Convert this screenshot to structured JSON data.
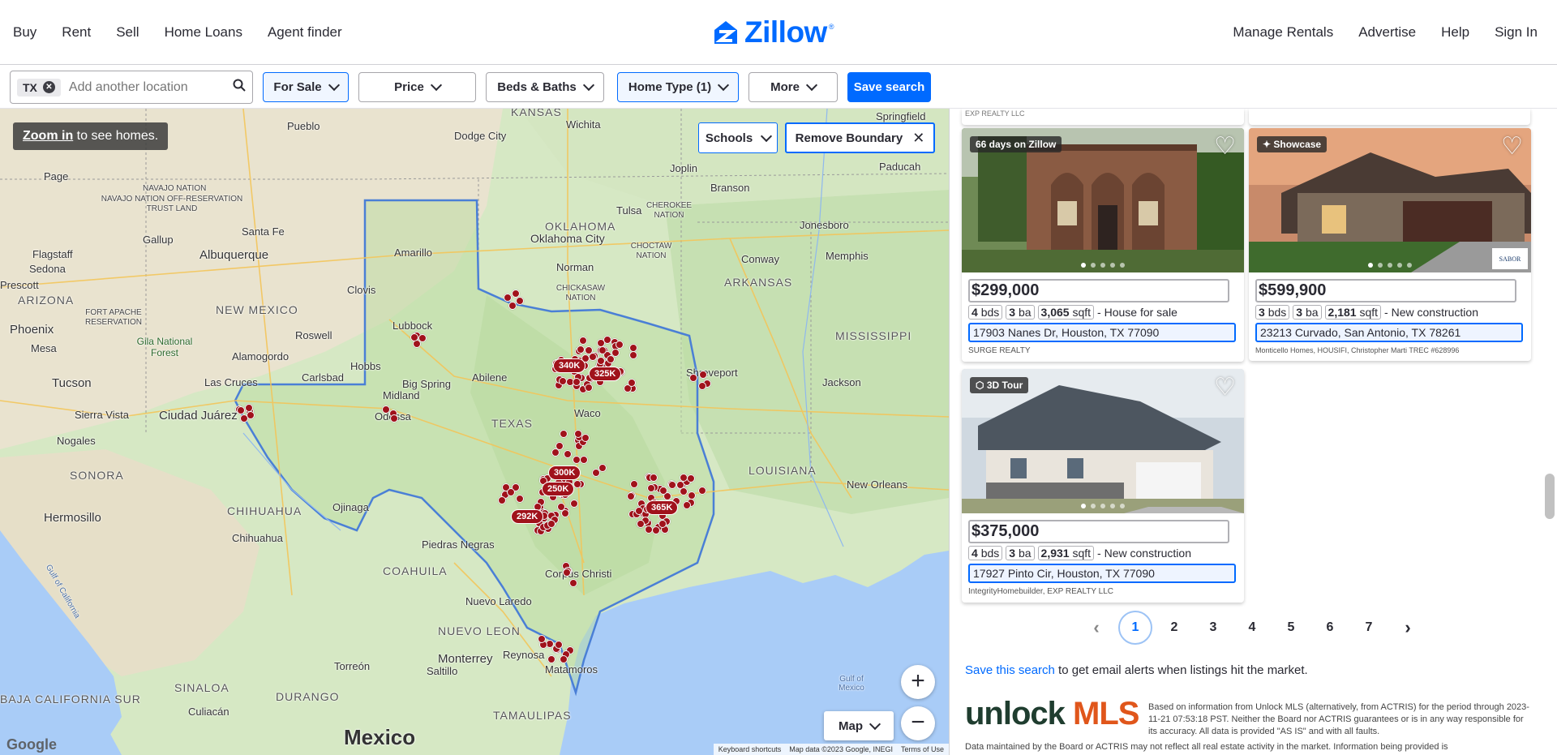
{
  "nav": {
    "left": [
      "Buy",
      "Rent",
      "Sell",
      "Home Loans",
      "Agent finder"
    ],
    "logo": "Zillow",
    "right": [
      "Manage Rentals",
      "Advertise",
      "Help",
      "Sign In"
    ]
  },
  "filters": {
    "location_chip": "TX",
    "search_placeholder": "Add another location",
    "for_sale": "For Sale",
    "price": "Price",
    "beds_baths": "Beds & Baths",
    "home_type": "Home Type (1)",
    "more": "More",
    "save_search": "Save search"
  },
  "map": {
    "zoom_tip_link": "Zoom in",
    "zoom_tip_rest": " to see homes.",
    "schools": "Schools",
    "remove_boundary": "Remove Boundary",
    "map_type": "Map",
    "attribution": [
      "Keyboard shortcuts",
      "Map data ©2023 Google, INEGI",
      "Terms of Use"
    ],
    "google": "Google",
    "country_label": "Mexico",
    "state_labels": [
      "KANSAS",
      "OKLAHOMA",
      "ARKANSAS",
      "NEW MEXICO",
      "ARIZONA",
      "TEXAS",
      "LOUISIANA",
      "MISSISSIPPI",
      "SONORA",
      "CHIHUAHUA",
      "COAHUILA",
      "NUEVO LEON",
      "DURANGO",
      "TAMAULIPAS",
      "SINALOA",
      "BAJA CALIFORNIA SUR"
    ],
    "region_labels": [
      "NAVAJO NATION",
      "NAVAJO NATION OFF-RESERVATION TRUST LAND",
      "FORT APACHE RESERVATION",
      "Gila National Forest",
      "CHICKASAW NATION",
      "CHOCTAW NATION",
      "CHEROKEE NATION",
      "Gulf of Mexico",
      "Gulf of California"
    ],
    "cities": [
      "Pueblo",
      "Dodge City",
      "Wichita",
      "Springfield",
      "Page",
      "Santa Fe",
      "Albuquerque",
      "Tulsa",
      "Joplin",
      "Branson",
      "Oklahoma City",
      "Amarillo",
      "Norman",
      "Jonesboro",
      "Conway",
      "Memphis",
      "Flagstaff",
      "Sedona",
      "Prescott",
      "Gallup",
      "Clovis",
      "Lubbock",
      "Roswell",
      "Phoenix",
      "Mesa",
      "Alamogordo",
      "Hobbs",
      "Carlsbad",
      "Tucson",
      "Las Cruces",
      "Big Spring",
      "Midland",
      "Odessa",
      "Abilene",
      "Shreveport",
      "Jackson",
      "Sierra Vista",
      "Ciudad Juárez",
      "Nogales",
      "Waco",
      "Hermosillo",
      "Ojinaga",
      "Chihuahua",
      "Piedras Negras",
      "Corpus Christi",
      "Nuevo Laredo",
      "Monterrey",
      "Saltillo",
      "Reynosa",
      "Matamoros",
      "Torreón",
      "Culiacán",
      "Paducah",
      "New Orleans"
    ],
    "price_pins": [
      "340K",
      "325K",
      "300K",
      "250K",
      "292K",
      "365K"
    ],
    "zoom_in": "+",
    "zoom_out": "−"
  },
  "listings": {
    "top_broker_cut": "EXP REALTY LLC",
    "cards": [
      {
        "badge": "66 days on Zillow",
        "price": "$299,000",
        "beds": "4",
        "beds_unit": "bds",
        "baths": "3",
        "baths_unit": "ba",
        "sqft": "3,065",
        "sqft_unit": "sqft",
        "type": "- House for sale",
        "address": "17903 Nanes Dr, Houston, TX 77090",
        "broker": "SURGE REALTY"
      },
      {
        "badge": "Showcase",
        "price": "$599,900",
        "beds": "3",
        "beds_unit": "bds",
        "baths": "3",
        "baths_unit": "ba",
        "sqft": "2,181",
        "sqft_unit": "sqft",
        "type": "- New construction",
        "address": "23213 Curvado, San Antonio, TX 78261",
        "broker": "Monticello Homes, HOUSIFI, Christopher Marti TREC #628996",
        "watermark": "SABOR"
      },
      {
        "badge": "3D Tour",
        "price": "$375,000",
        "beds": "4",
        "beds_unit": "bds",
        "baths": "3",
        "baths_unit": "ba",
        "sqft": "2,931",
        "sqft_unit": "sqft",
        "type": "- New construction",
        "address": "17927 Pinto Cir, Houston, TX 77090",
        "broker": "IntegrityHomebuilder, EXP REALTY LLC"
      }
    ],
    "pages": [
      "1",
      "2",
      "3",
      "4",
      "5",
      "6",
      "7"
    ],
    "current_page": "1",
    "save_link": "Save this search",
    "save_rest": " to get email alerts when listings hit the market.",
    "mls_logo_1": "unlock",
    "mls_logo_2": "MLS",
    "disclaimer": "Based on information from Unlock MLS (alternatively, from ACTRIS) for the period through 2023-11-21 07:53:18 PST. Neither the Board nor ACTRIS guarantees or is in any way responsible for its accuracy. All data is provided \"AS IS\" and with all faults.",
    "disclaimer2": "Data maintained by the Board or ACTRIS may not reflect all real estate activity in the market. Information being provided is"
  },
  "colors": {
    "brand": "#006aff",
    "pin": "#a0121b",
    "mls_green": "#1f3d2f",
    "mls_orange": "#e0561b"
  }
}
